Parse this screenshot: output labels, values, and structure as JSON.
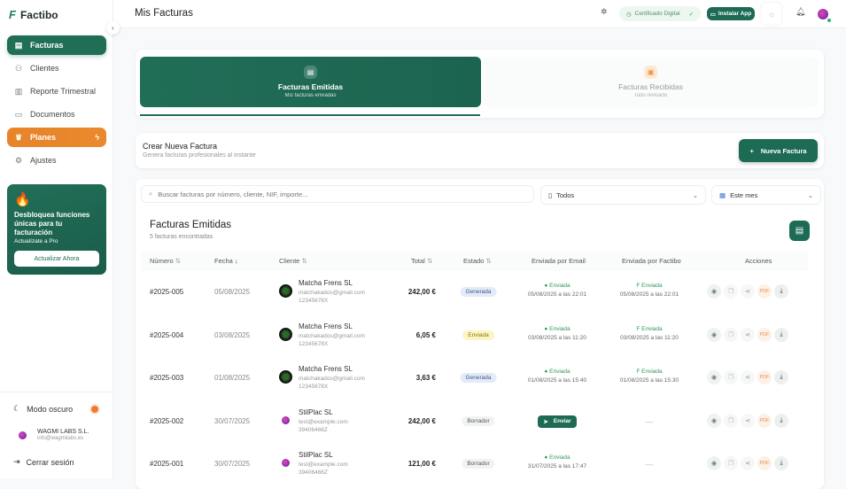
{
  "app": {
    "name": "Factibo",
    "brand_color": "#216e57",
    "accent_color": "#e8832a"
  },
  "sidebar": {
    "items": [
      {
        "label": "Facturas",
        "icon": "file-icon",
        "active": true
      },
      {
        "label": "Clientes",
        "icon": "users-icon"
      },
      {
        "label": "Reporte Trimestral",
        "icon": "chart-icon"
      },
      {
        "label": "Documentos",
        "icon": "folder-icon"
      },
      {
        "label": "Planes",
        "icon": "crown-icon",
        "highlight": true
      },
      {
        "label": "Ajustes",
        "icon": "gear-icon"
      }
    ],
    "promo": {
      "title": "Desbloquea funciones únicas para tu facturación",
      "subtitle": "Actualízate a Pro",
      "button": "Actualizar Ahora"
    },
    "dark_mode_label": "Modo oscuro",
    "company": {
      "name": "WAGMI LABS S.L.",
      "email": "info@wagmilabs.es"
    },
    "logout_label": "Cerrar sesión"
  },
  "header": {
    "title": "Mis Facturas",
    "certificate": "Certificado Digital",
    "install": "Instalar App"
  },
  "tabs": [
    {
      "title": "Facturas Emitidas",
      "subtitle": "Mis facturas enviadas",
      "active": true
    },
    {
      "title": "Facturas Recibidas",
      "subtitle": "Todo revisado"
    }
  ],
  "create": {
    "title": "Crear Nueva Factura",
    "subtitle": "Genera facturas profesionales al instante",
    "button": "Nueva Factura"
  },
  "filters": {
    "search_placeholder": "Buscar facturas por número, cliente, NIF, importe...",
    "status": "Todos",
    "period": "Este mes"
  },
  "table": {
    "title": "Facturas Emitidas",
    "count": "5 facturas encontradas",
    "columns": [
      "Número",
      "Fecha",
      "Cliente",
      "Total",
      "Estado",
      "Enviada por Email",
      "Enviada por Factibo",
      "Acciones"
    ],
    "pdf_label": "PDF",
    "send_label": "Enviar",
    "dash": "—",
    "rows": [
      {
        "number": "#2025-005",
        "date": "05/08/2025",
        "client": "Matcha Frens SL",
        "email": "matchakados@gmail.com",
        "nif": "12345678X",
        "total": "242,00 €",
        "status": "Generada",
        "email_status": "Enviada",
        "email_date": "05/08/2025 a las 22:01",
        "factibo_status": "Enviada",
        "factibo_date": "05/08/2025 a las 22:01"
      },
      {
        "number": "#2025-004",
        "date": "03/08/2025",
        "client": "Matcha Frens SL",
        "email": "matchakados@gmail.com",
        "nif": "12345678X",
        "total": "6,05 €",
        "status": "Enviada",
        "email_status": "Enviada",
        "email_date": "03/08/2025 a las 11:20",
        "factibo_status": "Enviada",
        "factibo_date": "03/08/2025 a las 11:20"
      },
      {
        "number": "#2025-003",
        "date": "01/08/2025",
        "client": "Matcha Frens SL",
        "email": "matchakados@gmail.com",
        "nif": "12345678X",
        "total": "3,63 €",
        "status": "Generada",
        "email_status": "Enviada",
        "email_date": "01/08/2025 a las 15:40",
        "factibo_status": "Enviada",
        "factibo_date": "01/08/2025 a las 15:30"
      },
      {
        "number": "#2025-002",
        "date": "30/07/2025",
        "client": "StilPlac SL",
        "email": "test@example.com",
        "nif": "39406466Z",
        "total": "242,00 €",
        "status": "Borrador",
        "email_status": null,
        "factibo_status": null
      },
      {
        "number": "#2025-001",
        "date": "30/07/2025",
        "client": "StilPlac SL",
        "email": "test@example.com",
        "nif": "39406466Z",
        "total": "121,00 €",
        "status": "Borrador",
        "email_status": "Enviada",
        "email_date": "31/07/2025 a las 17:47",
        "factibo_status": null
      }
    ]
  },
  "status_colors": {
    "Generada": "#e3ebf8",
    "Enviada": "#fbf5c4",
    "Borrador": "#f1f2f3"
  }
}
